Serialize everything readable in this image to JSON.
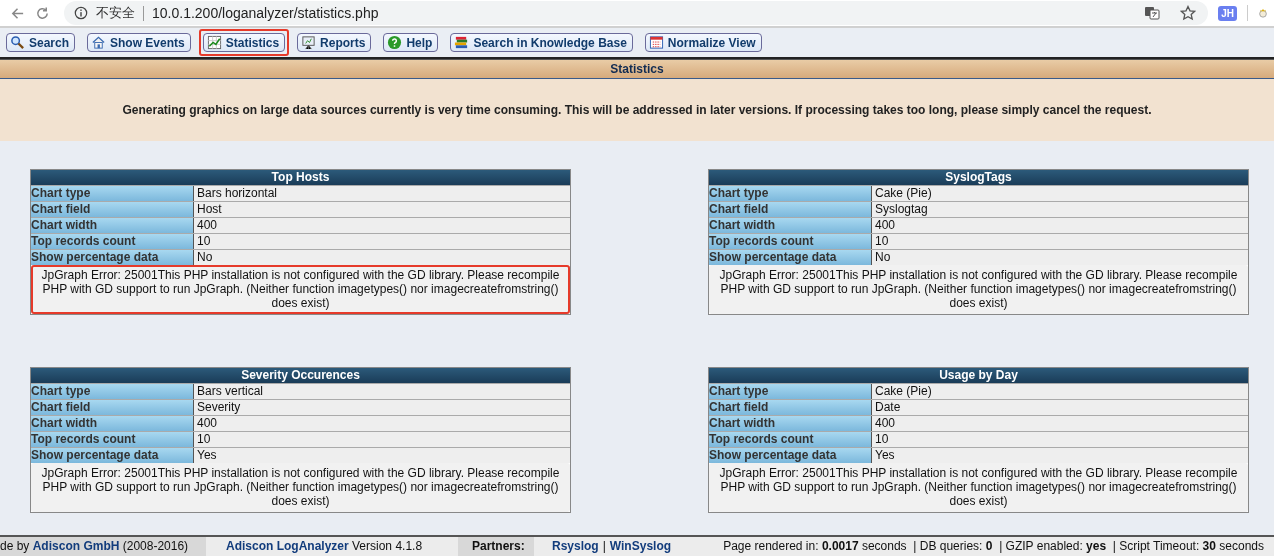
{
  "browser": {
    "insecure_label": "不安全",
    "url": "10.0.1.200/loganalyzer/statistics.php",
    "profile_initials": "JH"
  },
  "toolbar": [
    {
      "label": "Search",
      "highlighted": false
    },
    {
      "label": "Show Events",
      "highlighted": false
    },
    {
      "label": "Statistics",
      "highlighted": true
    },
    {
      "label": "Reports",
      "highlighted": false
    },
    {
      "label": "Help",
      "highlighted": false
    },
    {
      "label": "Search in Knowledge Base",
      "highlighted": false
    },
    {
      "label": "Normalize View",
      "highlighted": false
    }
  ],
  "page_title": "Statistics",
  "notice": "Generating graphics on large data sources currently is very time consuming. This will be addressed in later versions. If processing takes too long, please simply cancel the request.",
  "charts": [
    {
      "title": "Top Hosts",
      "highlighted": true,
      "fields": [
        {
          "label": "Chart type",
          "value": "Bars horizontal"
        },
        {
          "label": "Chart field",
          "value": "Host"
        },
        {
          "label": "Chart width",
          "value": "400"
        },
        {
          "label": "Top records count",
          "value": "10"
        },
        {
          "label": "Show percentage data",
          "value": "No"
        }
      ],
      "error": "JpGraph Error: 25001This PHP installation is not configured with the GD library. Please recompile PHP with GD support to run JpGraph. (Neither function imagetypes() nor imagecreatefromstring() does exist)"
    },
    {
      "title": "SyslogTags",
      "highlighted": false,
      "fields": [
        {
          "label": "Chart type",
          "value": "Cake (Pie)"
        },
        {
          "label": "Chart field",
          "value": "Syslogtag"
        },
        {
          "label": "Chart width",
          "value": "400"
        },
        {
          "label": "Top records count",
          "value": "10"
        },
        {
          "label": "Show percentage data",
          "value": "No"
        }
      ],
      "error": "JpGraph Error: 25001This PHP installation is not configured with the GD library. Please recompile PHP with GD support to run JpGraph. (Neither function imagetypes() nor imagecreatefromstring() does exist)"
    },
    {
      "title": "Severity Occurences",
      "highlighted": false,
      "fields": [
        {
          "label": "Chart type",
          "value": "Bars vertical"
        },
        {
          "label": "Chart field",
          "value": "Severity"
        },
        {
          "label": "Chart width",
          "value": "400"
        },
        {
          "label": "Top records count",
          "value": "10"
        },
        {
          "label": "Show percentage data",
          "value": "Yes"
        }
      ],
      "error": "JpGraph Error: 25001This PHP installation is not configured with the GD library. Please recompile PHP with GD support to run JpGraph. (Neither function imagetypes() nor imagecreatefromstring() does exist)"
    },
    {
      "title": "Usage by Day",
      "highlighted": false,
      "fields": [
        {
          "label": "Chart type",
          "value": "Cake (Pie)"
        },
        {
          "label": "Chart field",
          "value": "Date"
        },
        {
          "label": "Chart width",
          "value": "400"
        },
        {
          "label": "Top records count",
          "value": "10"
        },
        {
          "label": "Show percentage data",
          "value": "Yes"
        }
      ],
      "error": "JpGraph Error: 25001This PHP installation is not configured with the GD library. Please recompile PHP with GD support to run JpGraph. (Neither function imagetypes() nor imagecreatefromstring() does exist)"
    }
  ],
  "footer": {
    "made_by_prefix": "de by",
    "company_link": "Adiscon GmbH",
    "years": "(2008-2016)",
    "product_link": "Adiscon LogAnalyzer",
    "version": "Version 4.1.8",
    "partners_label": "Partners:",
    "partner_links": [
      "Rsyslog",
      "WinSyslog"
    ],
    "separator": "|",
    "stats": "Page rendered in: **0.0017** seconds  | DB queries: **0**  | GZIP enabled: **yes**  | Script Timeout: **30** seconds"
  }
}
